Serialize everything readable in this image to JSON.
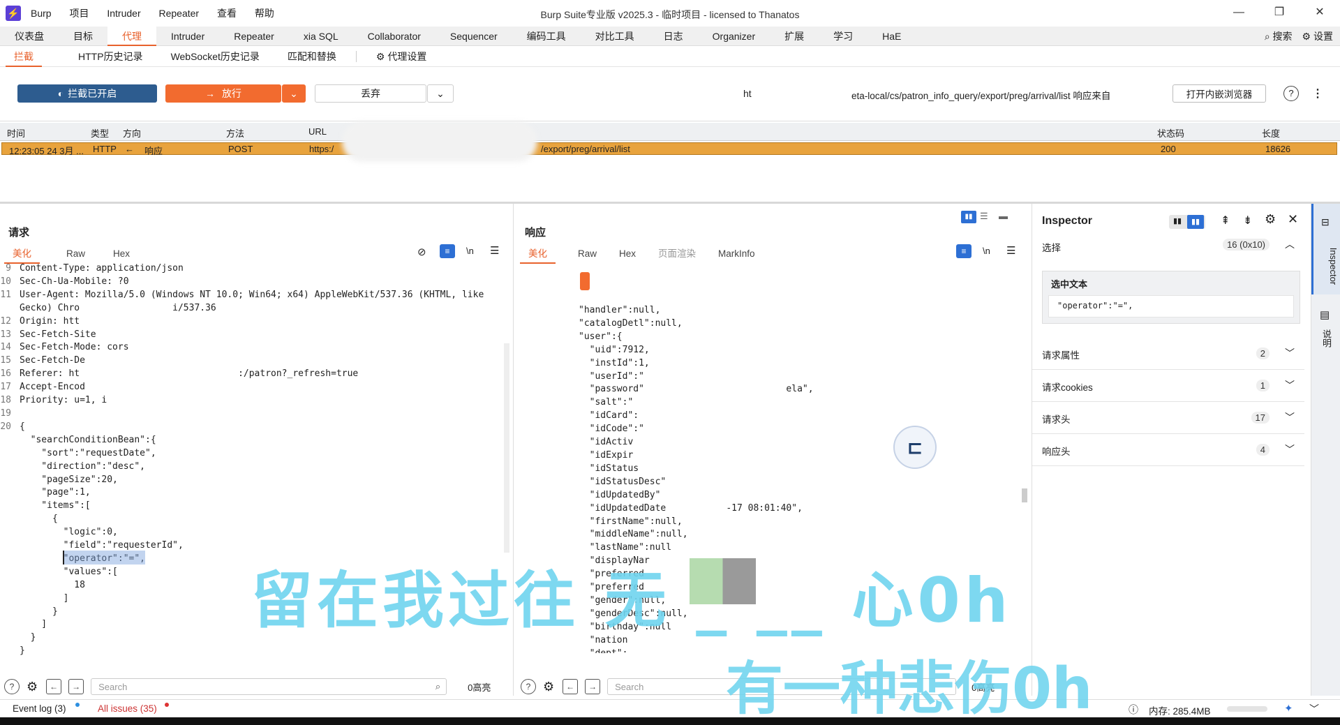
{
  "app": {
    "title": "Burp Suite专业版  v2025.3 - 临时项目 - licensed to Thanatos",
    "menu": [
      "Burp",
      "项目",
      "Intruder",
      "Repeater",
      "查看",
      "帮助"
    ],
    "window_controls": [
      "—",
      "❐",
      "✕"
    ]
  },
  "main_tabs": [
    "仪表盘",
    "目标",
    "代理",
    "Intruder",
    "Repeater",
    "xia SQL",
    "Collaborator",
    "Sequencer",
    "编码工具",
    "对比工具",
    "日志",
    "Organizer",
    "扩展",
    "学习",
    "HaE"
  ],
  "main_tabs_active": "代理",
  "main_tabs_right": {
    "search": "搜索",
    "settings": "设置"
  },
  "proxy_tabs": [
    "拦截",
    "HTTP历史记录",
    "WebSocket历史记录",
    "匹配和替换"
  ],
  "proxy_tabs_active": "拦截",
  "proxy_settings": "代理设置",
  "toolbar": {
    "intercept_on": "拦截已开启",
    "forward": "放行",
    "drop": "丢弃",
    "host_fragment": "ht",
    "url_info": "eta-local/cs/patron_info_query/export/preg/arrival/list 响应来自",
    "open_browser": "打开内嵌浏览器"
  },
  "history": {
    "columns": [
      "时间",
      "类型",
      "方向",
      "方法",
      "URL",
      "状态码",
      "长度"
    ],
    "rows": [
      {
        "time": "12:23:05 24 3月 ...",
        "type": "HTTP",
        "arrow": "←",
        "direction": "响应",
        "method": "POST",
        "url_start": "https:/",
        "url_end": "/export/preg/arrival/list",
        "status": "200",
        "length": "18626"
      }
    ]
  },
  "request": {
    "title": "请求",
    "tabs": [
      "美化",
      "Raw",
      "Hex"
    ],
    "line_numbers": [
      "9",
      "10",
      "11",
      "",
      "12",
      "13",
      "14",
      "15",
      "16",
      "17",
      "18",
      "19",
      "20"
    ],
    "lines": [
      "Content-Type: application/json",
      "Sec-Ch-Ua-Mobile: ?0",
      "User-Agent: Mozilla/5.0 (Windows NT 10.0; Win64; x64) AppleWebKit/537.36 (KHTML, like",
      "Gecko) Chro                 i/537.36",
      "Origin: htt",
      "Sec-Fetch-Site",
      "Sec-Fetch-Mode: cors",
      "Sec-Fetch-De",
      "Referer: ht                             :/patron?_refresh=true",
      "Accept-Encod",
      "Priority: u=1, i",
      "",
      "{",
      "  \"searchConditionBean\":{",
      "    \"sort\":\"requestDate\",",
      "    \"direction\":\"desc\",",
      "    \"pageSize\":20,",
      "    \"page\":1,",
      "    \"items\":[",
      "      {",
      "        \"logic\":0,",
      "        \"field\":\"requesterId\",",
      "        \"operator\":\"=\",",
      "        \"values\":[",
      "          18",
      "        ]",
      "      }",
      "    ]",
      "  }",
      "}"
    ],
    "search_placeholder": "Search",
    "highlights": "0高亮"
  },
  "response": {
    "title": "响应",
    "tabs": [
      "美化",
      "Raw",
      "Hex",
      "页面渲染",
      "MarkInfo"
    ],
    "lines": [
      "\"handler\":null,",
      "\"catalogDetl\":null,",
      "\"user\":{",
      "  \"uid\":7912,",
      "  \"instId\":1,",
      "  \"userId\":\"",
      "  \"password\"                          ela\",",
      "  \"salt\":\"",
      "  \"idCard\":",
      "  \"idCode\":\"",
      "  \"idActiv",
      "  \"idExpir",
      "  \"idStatus",
      "  \"idStatusDesc\"",
      "  \"idUpdatedBy\"",
      "  \"idUpdatedDate           -17 08:01:40\",",
      "  \"firstName\":null,",
      "  \"middleName\":null,",
      "  \"lastName\":null",
      "  \"displayNar",
      "  \"preferred",
      "  \"preferred",
      "  \"gender\":null,",
      "  \"genderDesc\":null,",
      "  \"birthday\":null",
      "  \"nation",
      "  \"dept\":"
    ],
    "search_placeholder": "Search",
    "highlights": "0高亮"
  },
  "inspector": {
    "title": "Inspector",
    "selection_label": "选择",
    "selection_count": "16 (0x10)",
    "selected_text_label": "选中文本",
    "selected_text": "\"operator\":\"=\",",
    "sections": [
      {
        "label": "请求属性",
        "count": "2"
      },
      {
        "label": "请求cookies",
        "count": "1"
      },
      {
        "label": "请求头",
        "count": "17"
      },
      {
        "label": "响应头",
        "count": "4"
      }
    ]
  },
  "side_tabs": [
    "Inspector",
    "说明"
  ],
  "status": {
    "event_log": "Event log (3)",
    "issues": "All issues (35)",
    "memory": "内存: 285.4MB"
  },
  "overlay": {
    "watermark_top": "留在我过往  无 _ __  心0h",
    "watermark_bottom": "有一种悲伤0h"
  },
  "colors": {
    "accent": "#e8612c",
    "intercept_blue": "#2d5c8f",
    "row_highlight": "#e8a33d"
  }
}
